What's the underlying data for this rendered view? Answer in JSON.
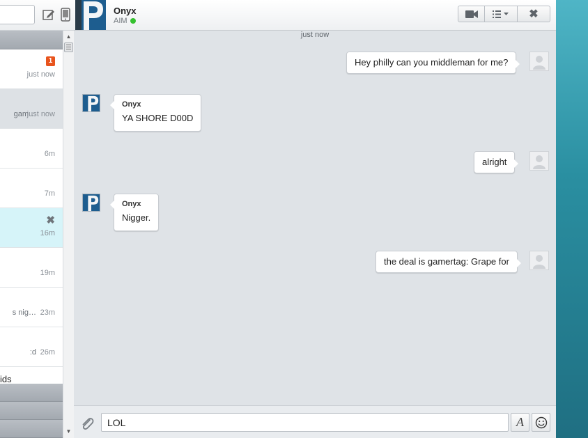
{
  "conversations": {
    "items": [
      {
        "preview": "",
        "time": "just now",
        "badge": "1"
      },
      {
        "preview": "gam…",
        "time": "just now"
      },
      {
        "preview": "",
        "time": "6m"
      },
      {
        "preview": "",
        "time": "7m"
      },
      {
        "preview": "",
        "time": "16m"
      },
      {
        "preview": "",
        "time": "19m"
      },
      {
        "preview": "s nig…",
        "time": "23m"
      },
      {
        "preview": ":d",
        "time": "26m"
      }
    ],
    "partial_label": "ids"
  },
  "chat": {
    "contact_name": "Onyx",
    "contact_service": "AIM",
    "timestamp": "just now",
    "messages": [
      {
        "dir": "out",
        "text": "Hey philly can you middleman for me?"
      },
      {
        "dir": "in",
        "sender": "Onyx",
        "text": "YA SHORE D00D"
      },
      {
        "dir": "out",
        "text": "alright"
      },
      {
        "dir": "in",
        "sender": "Onyx",
        "text": "Nigger."
      },
      {
        "dir": "out",
        "text": "the deal is gamertag: Grape for"
      }
    ]
  },
  "composer": {
    "value": "LOL",
    "font_button": "A"
  },
  "colors": {
    "badge": "#e8541d",
    "online": "#35c12f",
    "selected_row": "#dde1e5",
    "highlight_row": "#d6f4f9"
  }
}
